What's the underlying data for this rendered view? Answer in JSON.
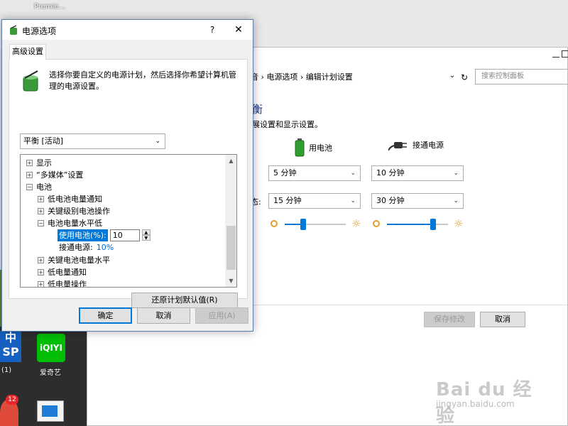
{
  "desktop": {
    "top_icon_label": "Premie...",
    "iqiyi_label": "爱奇艺",
    "iqiyi_logo": "iQIYI",
    "left_icon_text_1": "中",
    "left_icon_text_2": "SP",
    "left_icon_caption": "(1)",
    "badge_count": "12",
    "colors": {
      "desktop": "#dcdcdc",
      "iqiyi_green": "#00be06"
    }
  },
  "control_panel": {
    "breadcrumb": "音 › 电源选项 › 编辑计划设置",
    "search_placeholder": "搜索控制面板",
    "heading_fragment": "衡",
    "sub_fragment": "展设置和显示设置。",
    "on_battery_label": "用电池",
    "plugged_in_label": "接通电源",
    "row2_label_fragment": "态:",
    "display_off_battery": "5 分钟",
    "display_off_plugged": "10 分钟",
    "sleep_battery": "15 分钟",
    "sleep_plugged": "30 分钟",
    "brightness_battery": 0.3,
    "brightness_plugged": 0.75,
    "save_label": "保存修改",
    "cancel_label": "取消"
  },
  "dialog": {
    "title": "电源选项",
    "help_glyph": "?",
    "close_glyph": "✕",
    "tab_label": "高级设置",
    "description": "选择你要自定义的电源计划，然后选择你希望计算机管理的电源设置。",
    "plan_selected": "平衡 [活动]",
    "tree": {
      "display": "显示",
      "multimedia": "“多媒体”设置",
      "battery": "电池",
      "low_battery_notify": "低电池电量通知",
      "critical_action": "关键级别电池操作",
      "low_battery_level": "电池电量水平低",
      "on_battery_setting": "使用电池(%):",
      "on_battery_value": "10",
      "plugged_in_setting": "接通电源:",
      "plugged_in_value": "10%",
      "critical_level": "关键电池电量水平",
      "low_power_notify": "低电量通知",
      "low_power_action": "低电量操作"
    },
    "restore_label": "还原计划默认值(R)",
    "ok_label": "确定",
    "cancel_label": "取消",
    "apply_label": "应用(A)",
    "colors": {
      "accent": "#0078d7",
      "link": "#0066cc"
    }
  },
  "watermark": {
    "brand": "Bai du 经验",
    "url": "jingyan.baidu.com"
  }
}
